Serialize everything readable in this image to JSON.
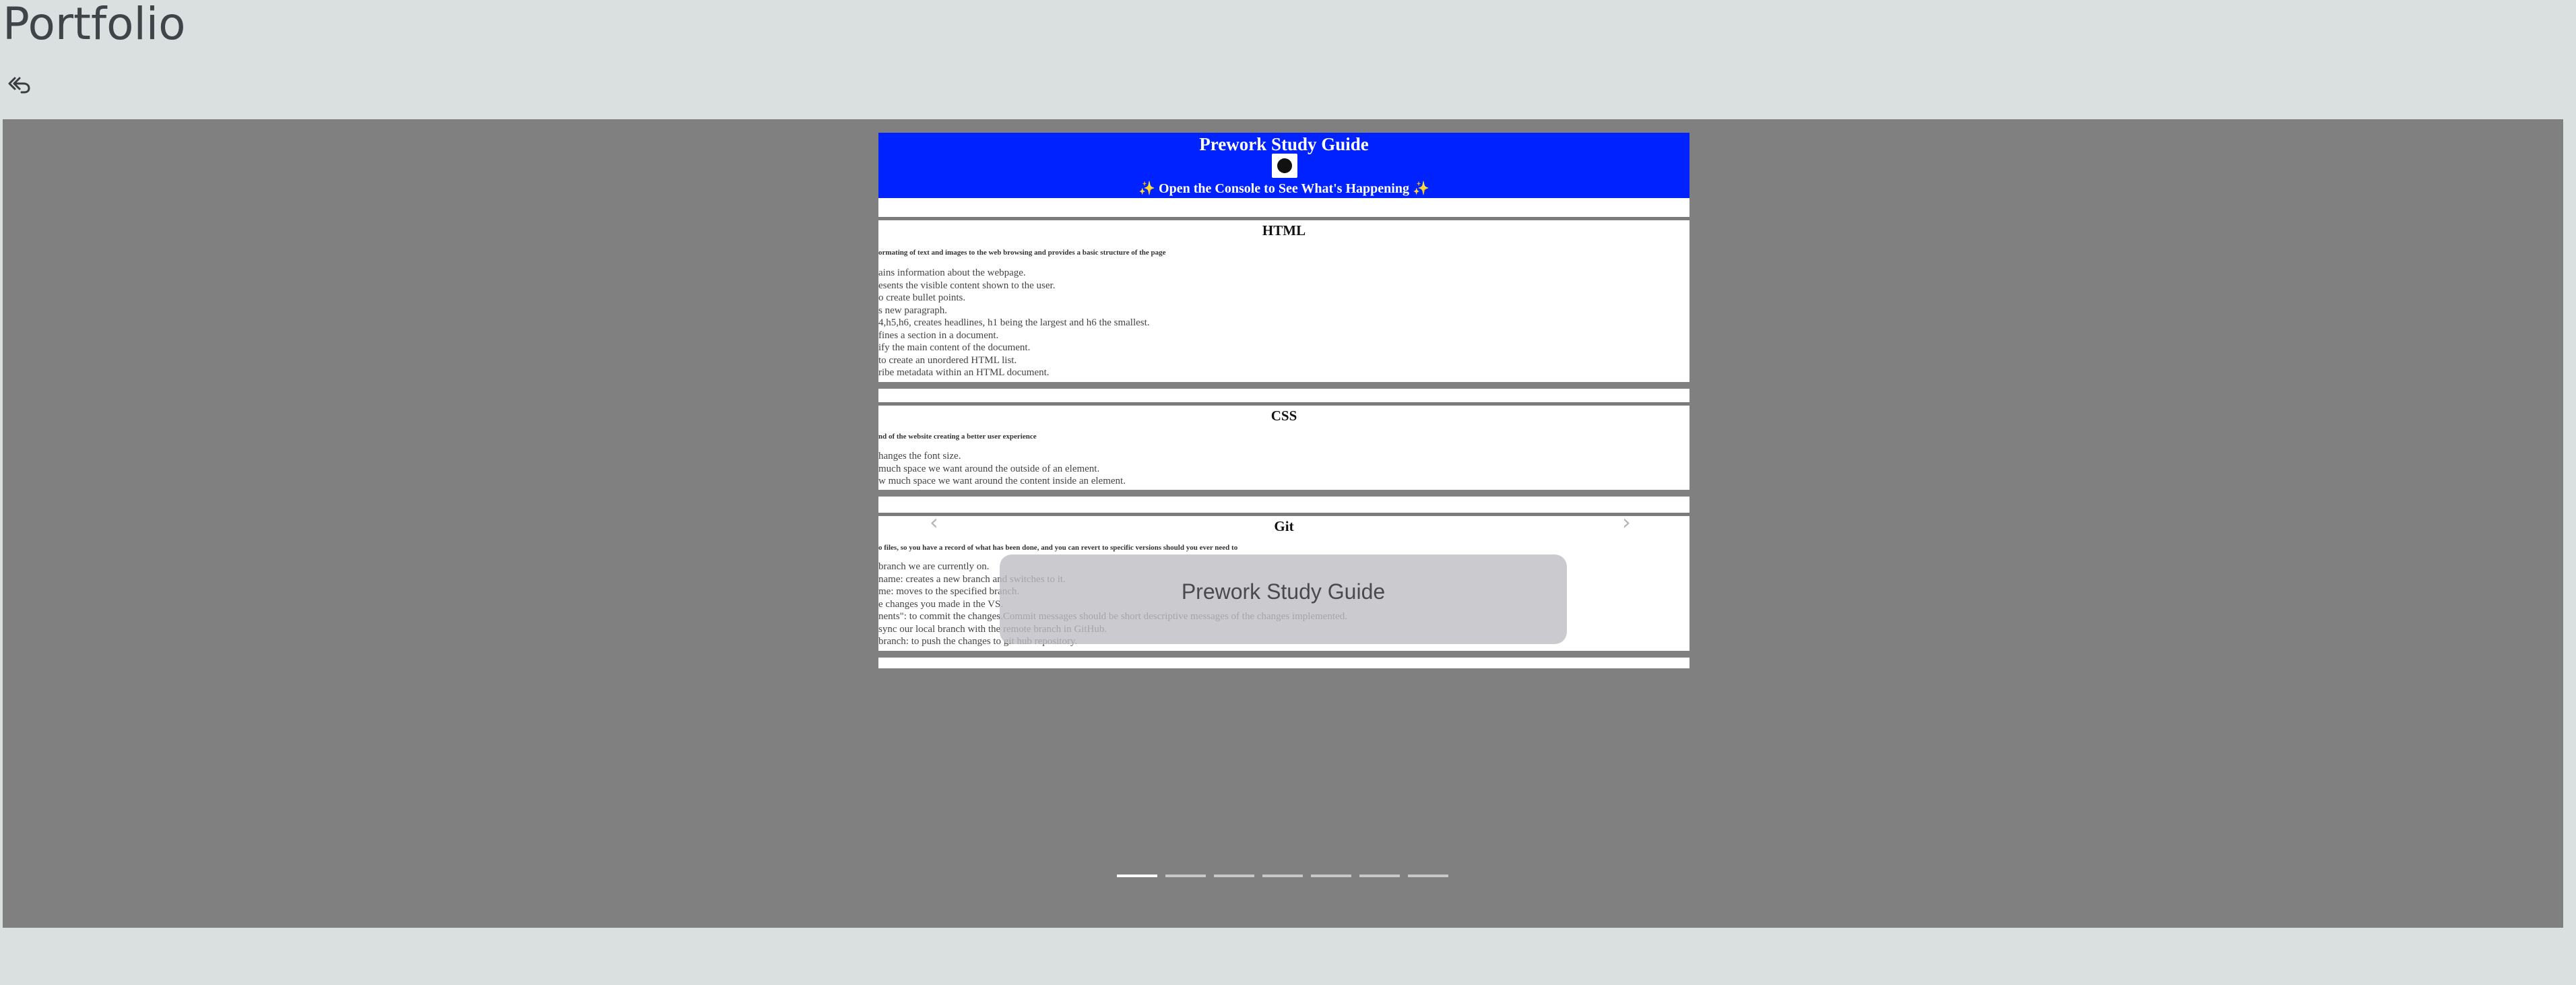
{
  "page": {
    "title": "Portfolio"
  },
  "nav": {
    "back_icon": "undo-all-icon"
  },
  "slide": {
    "header": {
      "title": "Prework Study Guide",
      "subtitle": "✨ Open the Console to See What's Happening ✨",
      "avatar_icon": "octocat-avatar-icon"
    },
    "sections": [
      {
        "heading": "HTML",
        "description": "ormating of text and images to the web browsing and provides a basic structure of the page",
        "items": [
          "ains information about the webpage.",
          "esents the visible content shown to the user.",
          "o create bullet points.",
          "s new paragraph.",
          "4,h5,h6, creates headlines, h1 being the largest and h6 the smallest.",
          "fines a section in a document.",
          "ify the main content of the document.",
          "to create an unordered HTML list.",
          "ribe metadata within an HTML document."
        ]
      },
      {
        "heading": "CSS",
        "description": "nd of the website creating a better user experience",
        "items": [
          "hanges the font size.",
          "much space we want around the outside of an element.",
          "w much space we want around the content inside an element."
        ]
      },
      {
        "heading": "Git",
        "description": "o files, so you have a record of what has been done, and you can revert to specific versions should you ever need to",
        "items": [
          "branch we are currently on.",
          "name: creates a new branch and switches to it.",
          "me: moves to the specified branch.",
          "e changes you made in the VS.",
          "nents\": to commit the changes.Commit messages should be short descriptive messages of the changes implemented.",
          "sync our local branch with the remote branch in GitHub.",
          " branch: to push the changes to git hub repository."
        ]
      }
    ]
  },
  "carousel": {
    "caption": "Prework Study Guide",
    "prev_icon": "chevron-left-icon",
    "next_icon": "chevron-right-icon",
    "slide_count": 7,
    "active_index": 0,
    "accent": "#0022ff"
  }
}
